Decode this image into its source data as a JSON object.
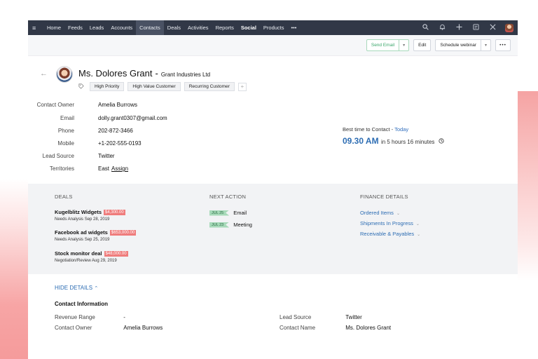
{
  "nav": {
    "items": [
      "Home",
      "Feeds",
      "Leads",
      "Accounts",
      "Contacts",
      "Deals",
      "Activities",
      "Reports",
      "Social",
      "Products"
    ],
    "more": "•••"
  },
  "toolbar": {
    "send_email": "Send Email",
    "edit": "Edit",
    "schedule_webinar": "Schedule webinar",
    "more": "•••"
  },
  "contact": {
    "name": "Ms. Dolores Grant",
    "separator": "-",
    "company": "Grant Industries Ltd",
    "tags": [
      "High Priority",
      "High Value Customer",
      "Recurring Customer"
    ],
    "tag_add": "+"
  },
  "fields": [
    {
      "label": "Contact Owner",
      "value": "Amelia Burrows"
    },
    {
      "label": "Email",
      "value": "dolly.grant0307@gmail.com"
    },
    {
      "label": "Phone",
      "value": "202-872-3466"
    },
    {
      "label": "Mobile",
      "value": "+1-202-555-0193"
    },
    {
      "label": "Lead Source",
      "value": "Twitter"
    },
    {
      "label": "Territories",
      "value": "East",
      "link": "Assign"
    }
  ],
  "best_time": {
    "label": "Best time to Contact -",
    "day": "Today",
    "time": "09.30 AM",
    "remaining": "in 5 hours 16 minutes"
  },
  "deals": {
    "heading": "DEALS",
    "items": [
      {
        "name": "Kugelblitz Widgets",
        "amount": "$4,300.00",
        "stage": "Needs Analysis Sep 28, 2019"
      },
      {
        "name": "Facebook ad widgets",
        "amount": "$653,000.00",
        "stage": "Needs Analysis Sep 25, 2019"
      },
      {
        "name": "Stock monitor deal",
        "amount": "$48,000.00",
        "stage": "Negotiation/Review Aug 29, 2019"
      }
    ]
  },
  "next_action": {
    "heading": "NEXT ACTION",
    "items": [
      {
        "date": "JUL 25",
        "label": "Email"
      },
      {
        "date": "JUL 23",
        "label": "Meeting"
      }
    ]
  },
  "finance": {
    "heading": "FINANCE DETAILS",
    "links": [
      "Ordered Items",
      "Shipments In Progress",
      "Receivable & Payables"
    ]
  },
  "hide_details": "HIDE DETAILS",
  "contact_info": {
    "title": "Contact Information",
    "left": [
      {
        "label": "Revenue Range",
        "value": "-"
      },
      {
        "label": "Contact Owner",
        "value": "Amelia Burrows"
      }
    ],
    "right": [
      {
        "label": "Lead Source",
        "value": "Twitter"
      },
      {
        "label": "Contact Name",
        "value": "Ms. Dolores Grant"
      }
    ]
  },
  "colors": {
    "navbar": "#313847",
    "accent_blue": "#2d6db3",
    "deal_amount": "#ef7c7c",
    "action_chip": "#a6d9b8",
    "send_green": "#3aa66a"
  }
}
